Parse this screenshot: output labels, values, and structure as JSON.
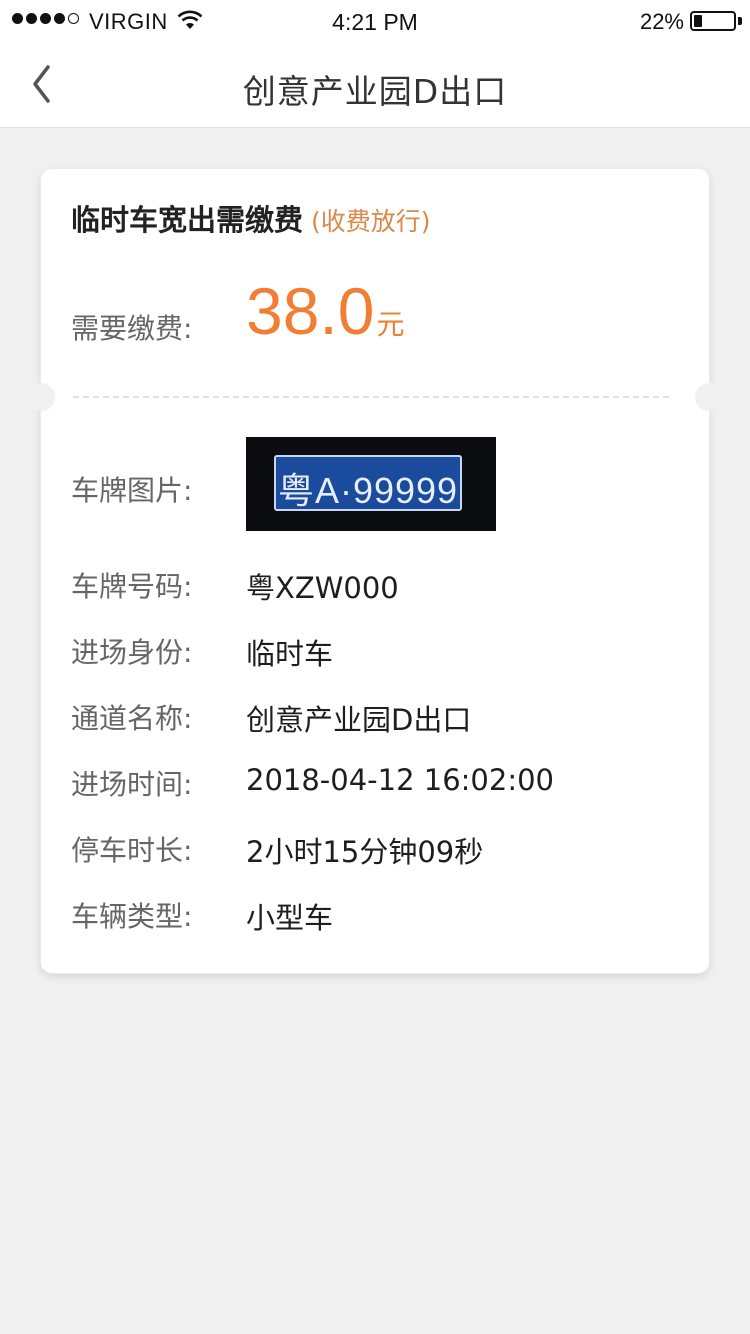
{
  "status_bar": {
    "carrier": "VIRGIN",
    "time": "4:21 PM",
    "battery_percent": "22%",
    "battery_level": 0.22,
    "signal_bars_filled": 4,
    "signal_bars_total": 5
  },
  "nav": {
    "title": "创意产业园D出口",
    "back_icon": "chevron-left-icon"
  },
  "card": {
    "title": "临时车宽出需缴费",
    "subtitle": "(收费放行)",
    "fee_label": "需要缴费:",
    "fee_amount": "38.0",
    "fee_unit": "元",
    "plate_image_label": "车牌图片:",
    "plate_image_text": "粤A·99999",
    "rows": [
      {
        "label": "车牌号码:",
        "value": "粤XZW000"
      },
      {
        "label": "进场身份:",
        "value": "临时车"
      },
      {
        "label": "通道名称:",
        "value": "创意产业园D出口"
      },
      {
        "label": "进场时间:",
        "value": "2018-04-12 16:02:00"
      },
      {
        "label": "停车时长:",
        "value": "2小时15分钟09秒"
      },
      {
        "label": "车辆类型:",
        "value": "小型车"
      }
    ]
  },
  "colors": {
    "accent_orange": "#f07f35",
    "subtitle_orange": "#d98a4a",
    "background": "#f0f0f1",
    "plate_blue": "#1a4b9c"
  }
}
